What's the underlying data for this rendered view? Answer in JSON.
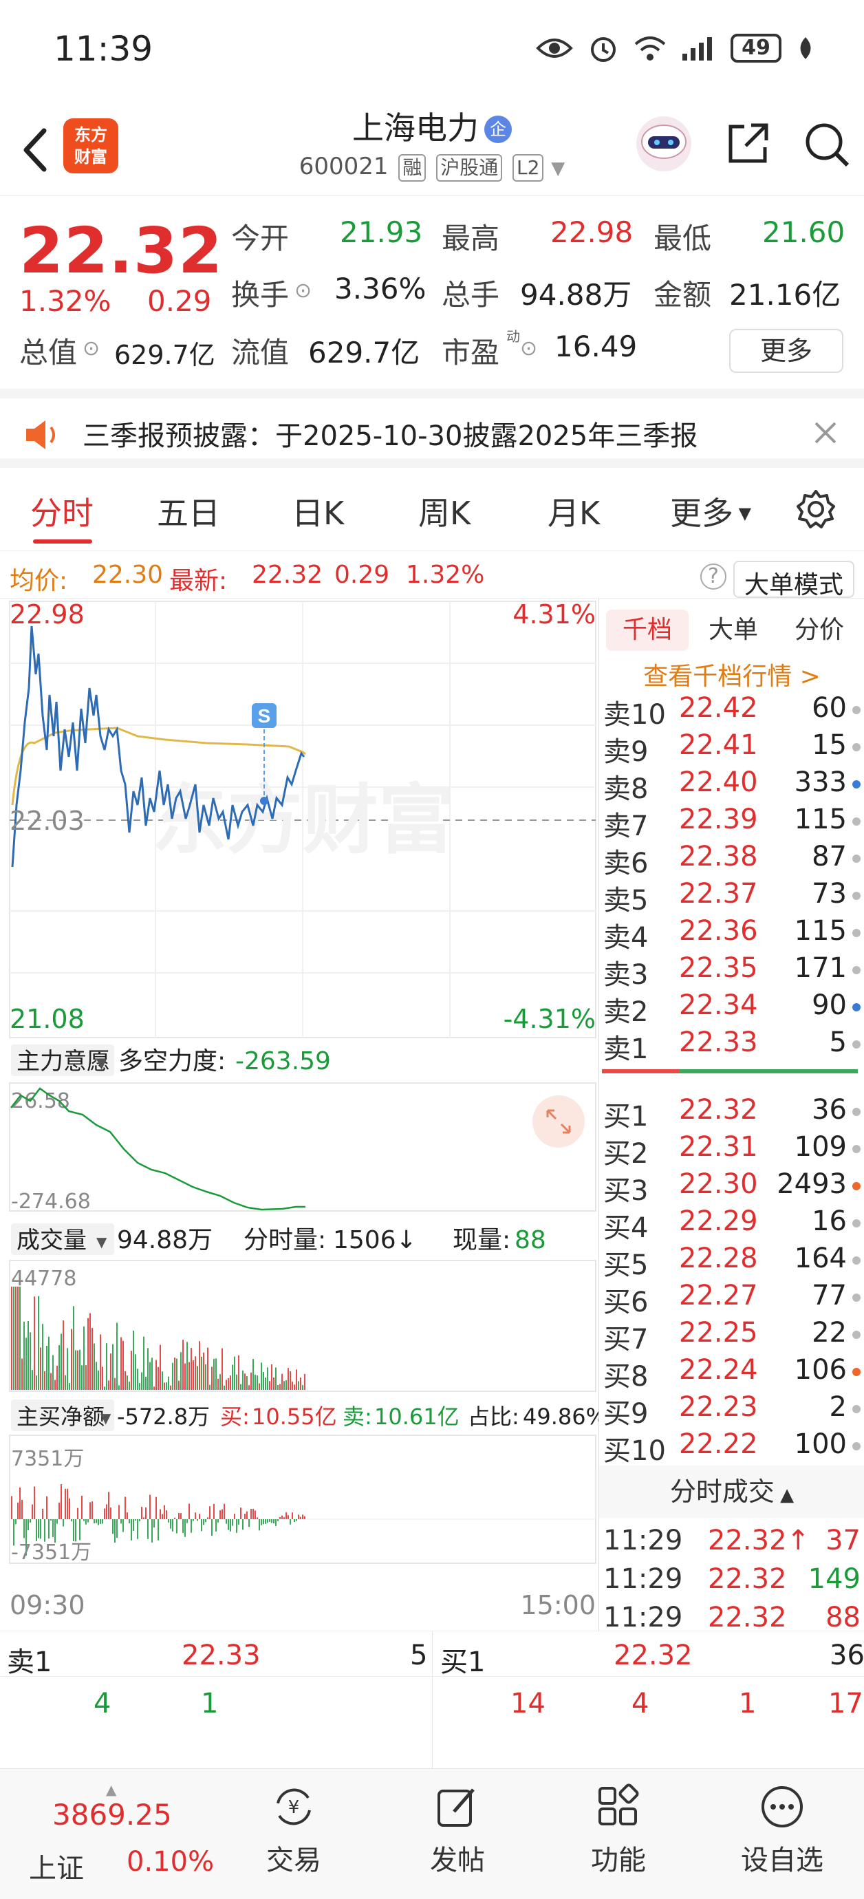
{
  "status_bar": {
    "time": "11:39",
    "battery": "49"
  },
  "header": {
    "logo_text_1": "东方",
    "logo_text_2": "财富",
    "stock_name": "上海电力",
    "stock_badge": "企",
    "stock_code": "600021",
    "tags": [
      "融",
      "沪股通",
      "L2"
    ]
  },
  "quote": {
    "price": "22.32",
    "change_pct": "1.32%",
    "change": "0.29",
    "open_label": "今开",
    "open": "21.93",
    "high_label": "最高",
    "high": "22.98",
    "low_label": "最低",
    "low": "21.60",
    "turnover_label": "换手",
    "turnover": "3.36%",
    "volume_label": "总手",
    "volume": "94.88万",
    "amount_label": "金额",
    "amount": "21.16亿",
    "mktcap_label": "总值",
    "mktcap": "629.7亿",
    "float_label": "流值",
    "float_cap": "629.7亿",
    "pe_label": "市盈",
    "pe_sup": "动",
    "pe": "16.49",
    "more_label": "更多"
  },
  "notice": {
    "text": "三季报预披露：于2025-10-30披露2025年三季报"
  },
  "tabs": [
    "分时",
    "五日",
    "日K",
    "周K",
    "月K",
    "更多"
  ],
  "avg_row": {
    "avg_label": "均价:",
    "avg": "22.30",
    "latest_label": "最新:",
    "latest": "22.32",
    "change": "0.29",
    "change_pct": "1.32%",
    "mode_button": "大单模式"
  },
  "chart": {
    "max_price": "22.98",
    "max_pct": "4.31%",
    "mid_price": "22.03",
    "min_price": "21.08",
    "min_pct": "-4.31%",
    "watermark": "东方财富",
    "marker": "S",
    "zhuli_label": "主力意愿",
    "duokong_label": "多空力度:",
    "duokong": "-263.59",
    "zhuli_top": "26.58",
    "zhuli_bottom": "-274.68",
    "vol_label": "成交量",
    "vol_total": "94.88万",
    "fenshi_label": "分时量:",
    "fenshi": "1506↓",
    "xianliang_label": "现量:",
    "xianliang": "88",
    "vol_max": "44778",
    "net_label": "主买净额",
    "net": "-572.8万",
    "buy_label": "买:",
    "buy": "10.55亿",
    "sell_label": "卖:",
    "sell": "10.61亿",
    "ratio_label": "占比:",
    "ratio": "49.86%",
    "net_top": "7351万",
    "net_bottom": "-7351万",
    "time_start": "09:30",
    "time_end": "15:00"
  },
  "orderbook": {
    "tabs": [
      "千档",
      "大单",
      "分价"
    ],
    "link": "查看千档行情 >",
    "asks": [
      {
        "label": "卖10",
        "price": "22.42",
        "vol": "60"
      },
      {
        "label": "卖9",
        "price": "22.41",
        "vol": "15"
      },
      {
        "label": "卖8",
        "price": "22.40",
        "vol": "333"
      },
      {
        "label": "卖7",
        "price": "22.39",
        "vol": "115"
      },
      {
        "label": "卖6",
        "price": "22.38",
        "vol": "87"
      },
      {
        "label": "卖5",
        "price": "22.37",
        "vol": "73"
      },
      {
        "label": "卖4",
        "price": "22.36",
        "vol": "115"
      },
      {
        "label": "卖3",
        "price": "22.35",
        "vol": "171"
      },
      {
        "label": "卖2",
        "price": "22.34",
        "vol": "90"
      },
      {
        "label": "卖1",
        "price": "22.33",
        "vol": "5"
      }
    ],
    "bids": [
      {
        "label": "买1",
        "price": "22.32",
        "vol": "36"
      },
      {
        "label": "买2",
        "price": "22.31",
        "vol": "109"
      },
      {
        "label": "买3",
        "price": "22.30",
        "vol": "2493"
      },
      {
        "label": "买4",
        "price": "22.29",
        "vol": "16"
      },
      {
        "label": "买5",
        "price": "22.28",
        "vol": "164"
      },
      {
        "label": "买6",
        "price": "22.27",
        "vol": "77"
      },
      {
        "label": "买7",
        "price": "22.25",
        "vol": "22"
      },
      {
        "label": "买8",
        "price": "22.24",
        "vol": "106"
      },
      {
        "label": "买9",
        "price": "22.23",
        "vol": "2"
      },
      {
        "label": "买10",
        "price": "22.22",
        "vol": "100"
      }
    ],
    "trades_title": "分时成交",
    "trades": [
      {
        "time": "11:29",
        "price": "22.32↑",
        "vol": "37"
      },
      {
        "time": "11:29",
        "price": "22.32",
        "vol": "149"
      },
      {
        "time": "11:29",
        "price": "22.32",
        "vol": "88"
      }
    ]
  },
  "bottom_quote": {
    "sell_label": "卖1",
    "sell_price": "22.33",
    "sell_vol": "5",
    "buy_label": "买1",
    "buy_price": "22.32",
    "buy_vol": "36",
    "sell_queue": [
      "4",
      "1"
    ],
    "buy_queue": [
      "14",
      "4",
      "1",
      "17"
    ]
  },
  "tabbar": {
    "index_value": "3869.25",
    "index_name": "上证",
    "index_pct": "0.10%",
    "items": [
      "交易",
      "发帖",
      "功能",
      "设自选"
    ]
  }
}
